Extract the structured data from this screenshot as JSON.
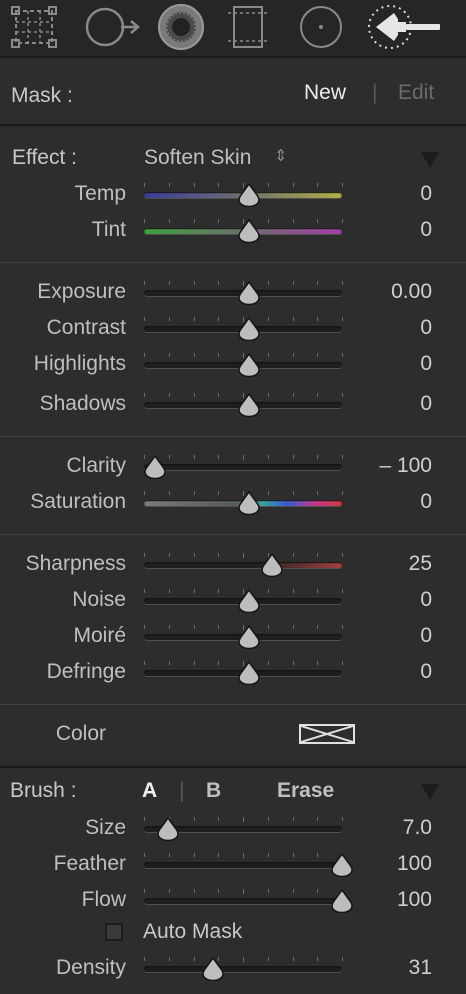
{
  "mask": {
    "label": "Mask :",
    "new_label": "New",
    "divider": "|",
    "edit_label": "Edit"
  },
  "effect": {
    "label": "Effect :",
    "preset": "Soften Skin",
    "preset_arrows": "⇕"
  },
  "sliders": {
    "temp": {
      "label": "Temp",
      "value": "0",
      "pos": 0.5
    },
    "tint": {
      "label": "Tint",
      "value": "0",
      "pos": 0.5
    },
    "exposure": {
      "label": "Exposure",
      "value": "0.00",
      "pos": 0.5
    },
    "contrast": {
      "label": "Contrast",
      "value": "0",
      "pos": 0.5
    },
    "highlights": {
      "label": "Highlights",
      "value": "0",
      "pos": 0.5
    },
    "shadows": {
      "label": "Shadows",
      "value": "0",
      "pos": 0.5
    },
    "clarity": {
      "label": "Clarity",
      "value": "– 100",
      "pos": 0.0
    },
    "saturation": {
      "label": "Saturation",
      "value": "0",
      "pos": 0.5
    },
    "sharpness": {
      "label": "Sharpness",
      "value": "25",
      "pos": 0.625
    },
    "noise": {
      "label": "Noise",
      "value": "0",
      "pos": 0.5
    },
    "moire": {
      "label": "Moiré",
      "value": "0",
      "pos": 0.5
    },
    "defringe": {
      "label": "Defringe",
      "value": "0",
      "pos": 0.5
    },
    "size": {
      "label": "Size",
      "value": "7.0",
      "pos": 0.07
    },
    "feather": {
      "label": "Feather",
      "value": "100",
      "pos": 1.0
    },
    "flow": {
      "label": "Flow",
      "value": "100",
      "pos": 1.0
    },
    "density": {
      "label": "Density",
      "value": "31",
      "pos": 0.31
    }
  },
  "color": {
    "label": "Color"
  },
  "brush": {
    "label": "Brush :",
    "tab_a": "A",
    "divider": "|",
    "tab_b": "B",
    "erase": "Erase"
  },
  "auto_mask": {
    "label": "Auto Mask",
    "checked": false
  },
  "colors": {
    "temp_gradient": [
      "#3a3a9a",
      "#b0b048"
    ],
    "tint_gradient": [
      "#3ca03c",
      "#a040a8"
    ],
    "sat_gradient": [
      "#7a7a7a",
      "#3aa0a0",
      "#3a5ad0",
      "#c03a8a",
      "#d03a3a"
    ],
    "sharp_gradient": [
      "#1e1e1e",
      "#a04040"
    ]
  }
}
